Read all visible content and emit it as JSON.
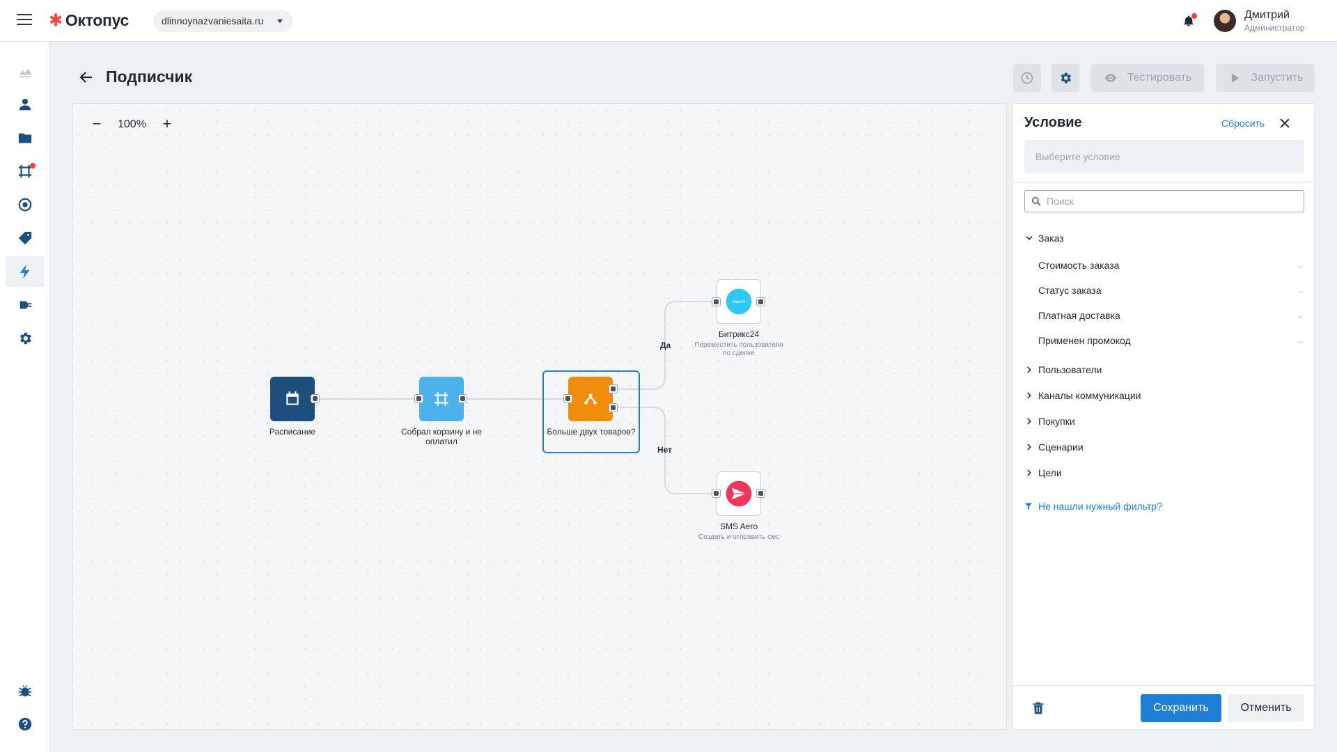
{
  "header": {
    "logo_text": "Октопус",
    "site": "dlinnoynazvaniesaita.ru",
    "user_name": "Дмитрий",
    "user_role": "Администратор"
  },
  "nav": {
    "items": [
      {
        "icon": "chart-icon"
      },
      {
        "icon": "user-icon"
      },
      {
        "icon": "folder-icon"
      },
      {
        "icon": "frame-icon",
        "badge": true
      },
      {
        "icon": "target-icon"
      },
      {
        "icon": "tag-icon"
      },
      {
        "icon": "lightning-icon",
        "active": true
      },
      {
        "icon": "plug-icon"
      },
      {
        "icon": "gear-icon"
      }
    ],
    "bottom": [
      {
        "icon": "bug-icon"
      },
      {
        "icon": "help-icon"
      }
    ]
  },
  "page": {
    "title": "Подписчик",
    "test_label": "Тестировать",
    "run_label": "Запустить"
  },
  "canvas": {
    "zoom": "100%",
    "zoom_out": "−",
    "zoom_in": "+",
    "nodes": [
      {
        "id": "schedule",
        "label": "Расписание",
        "color": "#1d4f7c",
        "icon": "calendar-icon"
      },
      {
        "id": "cart",
        "label": "Собрал корзину и не оплатил",
        "color": "#4db1ec",
        "icon": "frame-icon"
      },
      {
        "id": "condition",
        "label": "Больше двух товаров?",
        "color": "#f08c0c",
        "icon": "branch-icon",
        "selected": true
      },
      {
        "id": "bitrix",
        "label": "Битрикс24",
        "sublabel": "Переместить пользователя по сделке",
        "color": "#2fc7f7",
        "icon": "bitrix-icon",
        "icon_text": "Bitrix24"
      },
      {
        "id": "sms",
        "label": "SMS Aero",
        "sublabel": "Создать и отправить смс",
        "color": "#f0365a",
        "icon": "send-icon"
      }
    ],
    "edges": [
      {
        "label": "Да"
      },
      {
        "label": "Нет"
      }
    ]
  },
  "panel": {
    "title": "Условие",
    "reset": "Сбросить",
    "select_placeholder": "Выберите условие",
    "search_placeholder": "Поиск",
    "groups": [
      {
        "label": "Заказ",
        "expanded": true,
        "items": [
          "Стоимость заказа",
          "Статус заказа",
          "Платная доставка",
          "Применен промокод"
        ]
      },
      {
        "label": "Пользователи"
      },
      {
        "label": "Каналы коммуникации"
      },
      {
        "label": "Покупки"
      },
      {
        "label": "Сценарии"
      },
      {
        "label": "Цели"
      }
    ],
    "help": "Не нашли нужный фильтр?",
    "save": "Сохранить",
    "cancel": "Отменить"
  },
  "colors": {
    "accent": "#1f7fd6",
    "brand": "#ee4540"
  }
}
